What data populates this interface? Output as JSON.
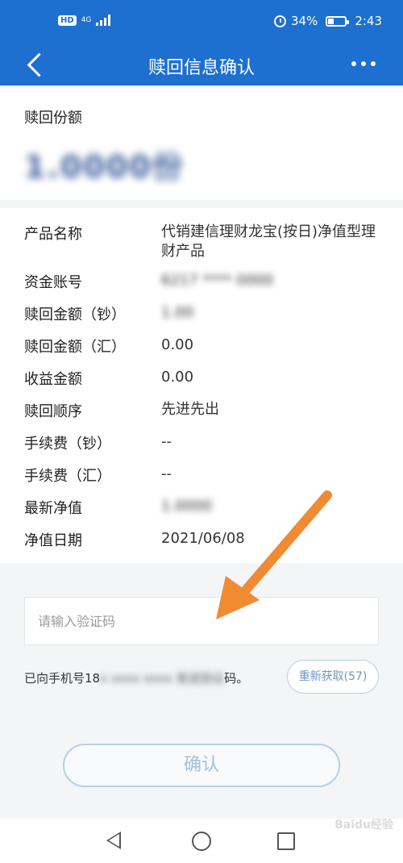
{
  "status_bar": {
    "left_badges": [
      "HD",
      "4G"
    ],
    "battery": "34%",
    "battery_level": 0.34,
    "time": "2:43"
  },
  "header": {
    "title": "赎回信息确认",
    "back_icon": "chevron-left-icon",
    "more_icon": "more-dots-icon"
  },
  "amount": {
    "label": "赎回份额",
    "value": "1.0000份"
  },
  "details": [
    {
      "key": "产品名称",
      "value": "代销建信理财龙宝(按日)净值型理财产品"
    },
    {
      "key": "资金账号",
      "value": "6217 **** 0000"
    },
    {
      "key": "赎回金额（钞）",
      "value": "1.00"
    },
    {
      "key": "赎回金额（汇）",
      "value": "0.00"
    },
    {
      "key": "收益金额",
      "value": "0.00"
    },
    {
      "key": "赎回顺序",
      "value": "先进先出"
    },
    {
      "key": "手续费（钞）",
      "value": "--"
    },
    {
      "key": "手续费（汇）",
      "value": "--"
    },
    {
      "key": "最新净值",
      "value": "1.0000"
    },
    {
      "key": "净值日期",
      "value": "2021/06/08"
    }
  ],
  "verification": {
    "placeholder": "请输入验证码",
    "sms_prefix": "已向手机号18",
    "sms_masked": "x xxxx xxxx 发送验证",
    "sms_suffix": "码。",
    "resend_label": "重新获取(57)"
  },
  "confirm_label": "确认",
  "watermark": "Baidu经验",
  "colors": {
    "header_bg": "#1d6fd0",
    "annotation_arrow": "#f08a33",
    "button_border": "#b7cfe8"
  }
}
